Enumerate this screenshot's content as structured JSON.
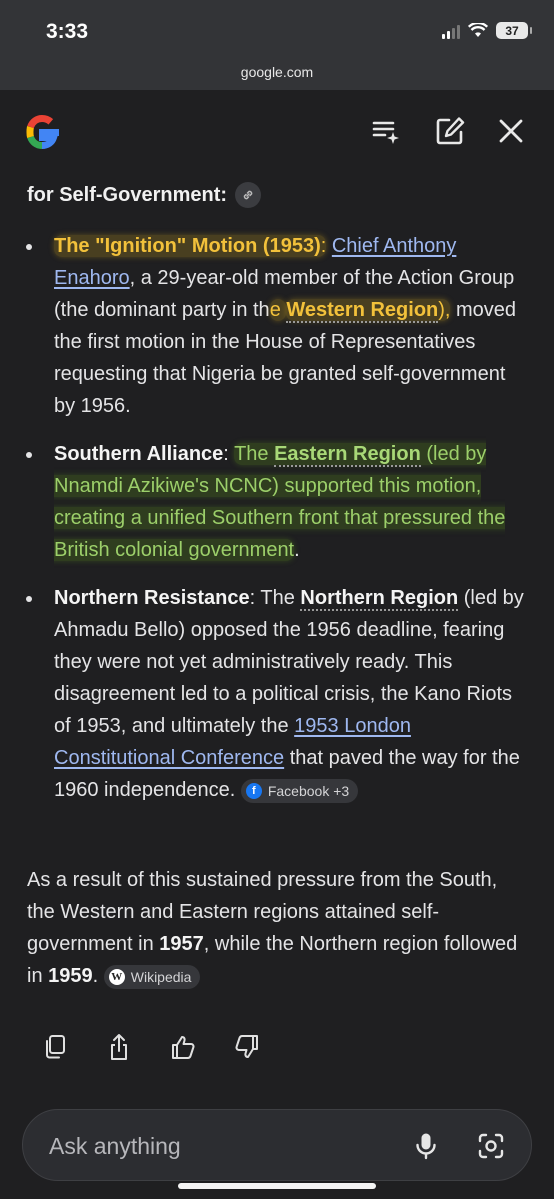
{
  "status": {
    "time": "3:33",
    "battery": "37",
    "url": "google.com"
  },
  "header": {
    "logo": "google-g-logo",
    "icons": [
      "list-sparkle-icon",
      "edit-icon",
      "close-icon"
    ]
  },
  "section": {
    "title": "for Self-Government",
    "title_colon": ":"
  },
  "bullets": [
    {
      "head": "The \"Ignition\" Motion (1953)",
      "sep": ":",
      "link": "Chief Anthony Enahoro",
      "text1": ", a 29-year-old member of the Action Group (the dominant party in th",
      "hl_tail": "e ",
      "region": "Western Region",
      "region_after": "),",
      "text2": " moved the first motion in the House of Representatives requesting that Nigeria be granted self-government by 1956."
    },
    {
      "head": "Southern Alliance",
      "sep": ": ",
      "pre": "The ",
      "region": "Eastern Region",
      "text": " (led by Nnamdi Azikiwe's NCNC) supported this motion, creating a unified Southern front that pressured the British colonial government",
      "end": "."
    },
    {
      "head": "Northern Resistance",
      "sep": ": The ",
      "region": "Northern Region",
      "text1": " (led by Ahmadu Bello) opposed the 1956 deadline, fearing they were not yet administratively ready. This disagreement led to a political crisis, the Kano Riots of 1953, and ultimately the ",
      "link": "1953 London Constitutional Conference",
      "text2": " that paved the way for the 1960 independence. ",
      "source": "Facebook +3"
    }
  ],
  "summary": {
    "t1": "As a result of this sustained pressure from the South, the Western and Eastern regions attained self-government in ",
    "y1": "1957",
    "t2": ", while the Northern region followed in ",
    "y2": "1959",
    "t3": ". ",
    "source": "Wikipedia"
  },
  "actions": [
    "copy-icon",
    "share-icon",
    "thumbs-up-icon",
    "thumbs-down-icon"
  ],
  "ask": {
    "placeholder": "Ask anything"
  }
}
